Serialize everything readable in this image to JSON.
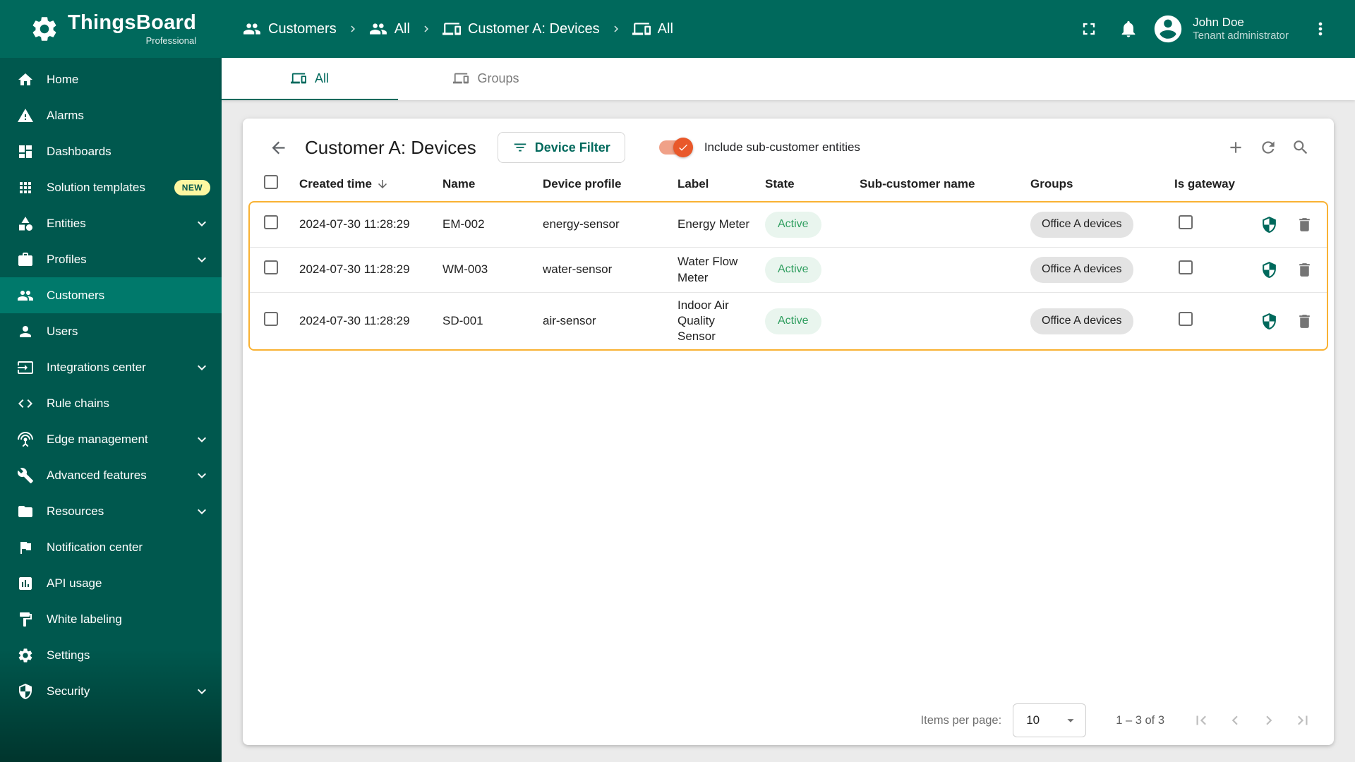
{
  "brand": {
    "name": "ThingsBoard",
    "subtitle": "Professional"
  },
  "header": {
    "breadcrumbs": [
      {
        "label": "Customers",
        "icon": "customers-icon"
      },
      {
        "label": "All",
        "icon": "customers-icon"
      },
      {
        "label": "Customer A: Devices",
        "icon": "devices-icon"
      },
      {
        "label": "All",
        "icon": "devices-icon"
      }
    ],
    "user": {
      "name": "John Doe",
      "role": "Tenant administrator"
    }
  },
  "sidebar": {
    "items": [
      {
        "label": "Home",
        "icon": "home-icon"
      },
      {
        "label": "Alarms",
        "icon": "alarm-icon"
      },
      {
        "label": "Dashboards",
        "icon": "dashboards-icon"
      },
      {
        "label": "Solution templates",
        "icon": "solution-templates-icon",
        "badge": "NEW"
      },
      {
        "label": "Entities",
        "icon": "entities-icon",
        "expandable": true
      },
      {
        "label": "Profiles",
        "icon": "profiles-icon",
        "expandable": true
      },
      {
        "label": "Customers",
        "icon": "customers-icon",
        "selected": true
      },
      {
        "label": "Users",
        "icon": "users-icon"
      },
      {
        "label": "Integrations center",
        "icon": "integrations-icon",
        "expandable": true
      },
      {
        "label": "Rule chains",
        "icon": "rule-chains-icon"
      },
      {
        "label": "Edge management",
        "icon": "edge-management-icon",
        "expandable": true
      },
      {
        "label": "Advanced features",
        "icon": "advanced-features-icon",
        "expandable": true
      },
      {
        "label": "Resources",
        "icon": "resources-icon",
        "expandable": true
      },
      {
        "label": "Notification center",
        "icon": "notification-center-icon"
      },
      {
        "label": "API usage",
        "icon": "api-usage-icon"
      },
      {
        "label": "White labeling",
        "icon": "white-labeling-icon"
      },
      {
        "label": "Settings",
        "icon": "settings-gear-icon"
      },
      {
        "label": "Security",
        "icon": "security-shield-icon",
        "expandable": true
      }
    ]
  },
  "tabs": [
    {
      "label": "All",
      "icon": "devices-icon",
      "selected": true
    },
    {
      "label": "Groups",
      "icon": "devices-icon",
      "selected": false
    }
  ],
  "toolbar": {
    "title": "Customer A: Devices",
    "filter_button_label": "Device Filter",
    "toggle_label": "Include sub-customer entities",
    "toggle_on": true
  },
  "table": {
    "columns": [
      "Created time",
      "Name",
      "Device profile",
      "Label",
      "State",
      "Sub-customer name",
      "Groups",
      "Is gateway"
    ],
    "sorted_column": "Created time",
    "rows": [
      {
        "created": "2024-07-30 11:28:29",
        "name": "EM-002",
        "profile": "energy-sensor",
        "label": "Energy Meter",
        "state": "Active",
        "sub_customer": "",
        "groups": "Office A devices",
        "is_gateway": false
      },
      {
        "created": "2024-07-30 11:28:29",
        "name": "WM-003",
        "profile": "water-sensor",
        "label": "Water Flow Meter",
        "state": "Active",
        "sub_customer": "",
        "groups": "Office A devices",
        "is_gateway": false
      },
      {
        "created": "2024-07-30 11:28:29",
        "name": "SD-001",
        "profile": "air-sensor",
        "label": "Indoor Air Quality Sensor",
        "state": "Active",
        "sub_customer": "",
        "groups": "Office A devices",
        "is_gateway": false
      }
    ]
  },
  "pagination": {
    "items_per_page_label": "Items per page:",
    "items_per_page": "10",
    "range": "1 – 3 of 3"
  },
  "colors": {
    "topbar": "#00695c",
    "sidebar": "#00584e",
    "sidebar_selected": "#00796b",
    "accent": "#00695c",
    "highlight_border": "#f9b233",
    "toggle_on": "#e9582a",
    "active_chip_bg": "#e9f5ee",
    "active_chip_text": "#2f9e5f",
    "new_badge_bg": "#fdf7a1"
  }
}
